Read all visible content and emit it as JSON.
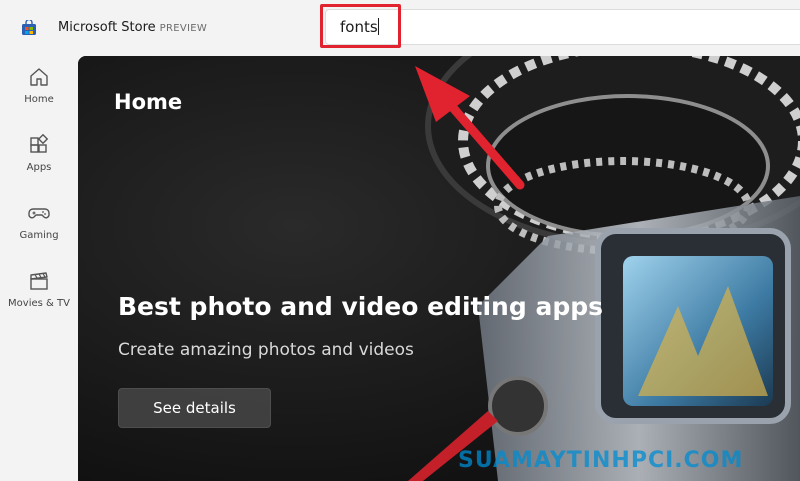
{
  "titlebar": {
    "app_name": "Microsoft Store",
    "app_tag": "PREVIEW",
    "app_icon": "store-icon"
  },
  "search": {
    "value": "fonts",
    "highlight_color": "#e0232e"
  },
  "sidebar": {
    "items": [
      {
        "label": "Home",
        "icon": "home-icon"
      },
      {
        "label": "Apps",
        "icon": "apps-icon"
      },
      {
        "label": "Gaming",
        "icon": "gamepad-icon"
      },
      {
        "label": "Movies & TV",
        "icon": "clapperboard-icon"
      }
    ]
  },
  "hero": {
    "heading": "Home",
    "promo_title": "Best photo and video editing apps",
    "promo_subtitle": "Create amazing photos and videos",
    "cta_label": "See details"
  },
  "watermark": {
    "text": "SUAMAYTINHPCI.COM"
  },
  "colors": {
    "accent": "#e0232e",
    "watermark": "#0a8cd2"
  }
}
